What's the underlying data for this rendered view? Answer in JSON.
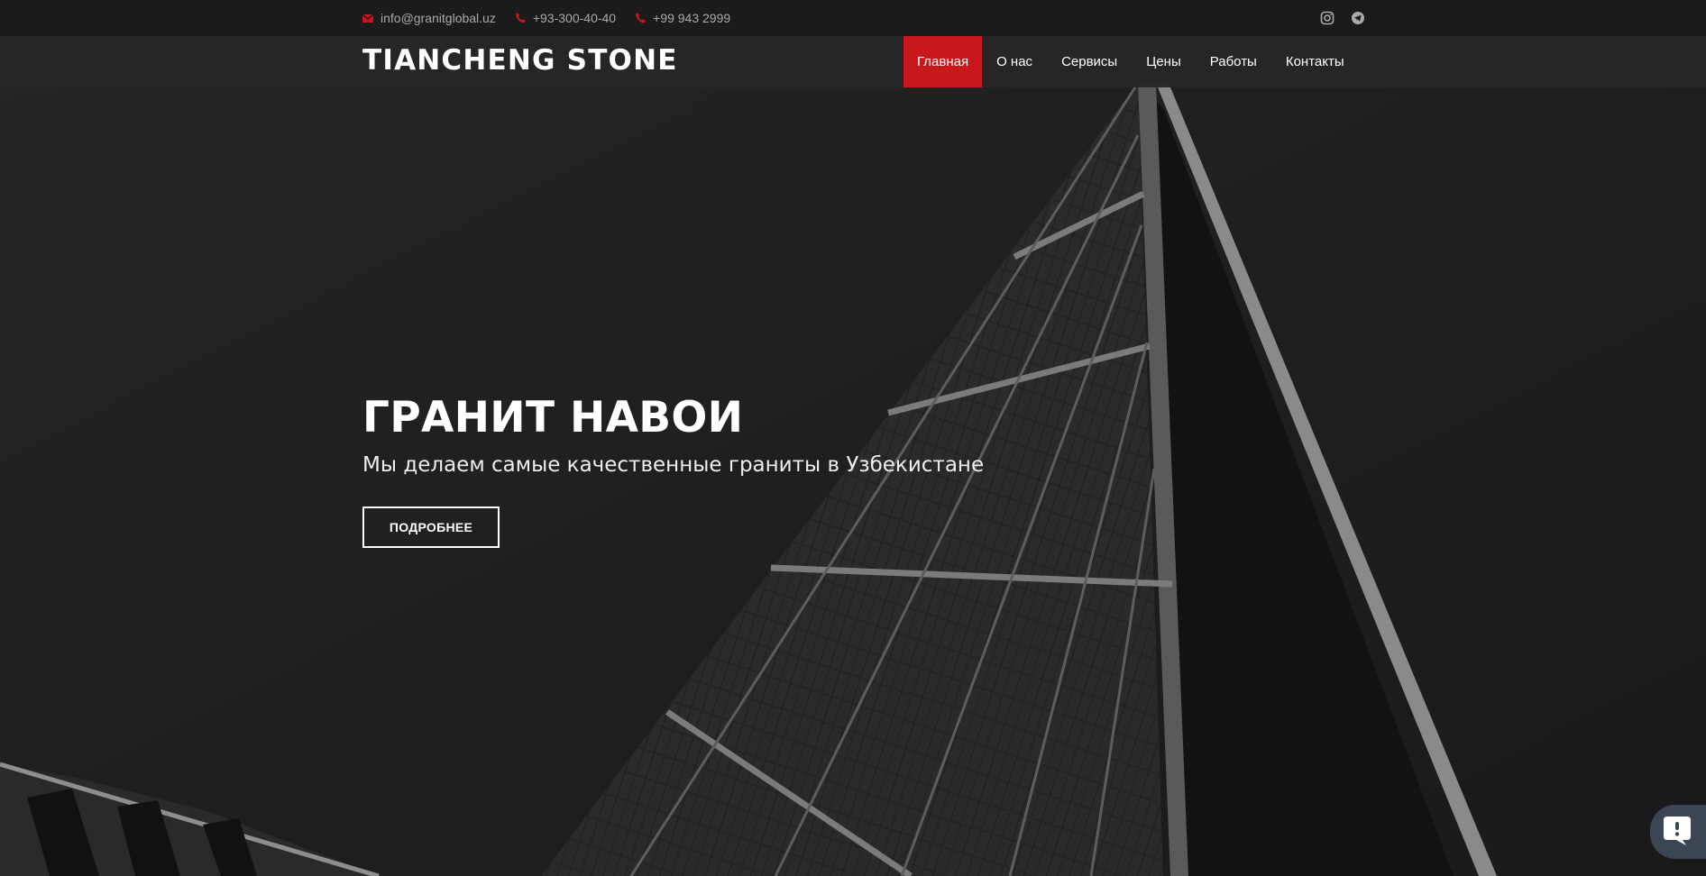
{
  "topbar": {
    "email": "info@granitglobal.uz",
    "phone_1": "+93-300-40-40",
    "phone_2": "+99 943 2999",
    "icons": [
      "envelope-icon",
      "phone-icon",
      "phone-icon",
      "instagram-icon",
      "telegram-icon"
    ]
  },
  "header": {
    "logo": "TIANCHENG STONE",
    "menu": [
      {
        "label": "Главная",
        "active": true
      },
      {
        "label": "О нас",
        "active": false
      },
      {
        "label": "Сервисы",
        "active": false
      },
      {
        "label": "Цены",
        "active": false
      },
      {
        "label": "Работы",
        "active": false
      },
      {
        "label": "Контакты",
        "active": false
      }
    ]
  },
  "hero": {
    "title": "ГРАНИТ НАВОИ",
    "subtitle": "Мы делаем самые качественные граниты в Узбекистане",
    "button": "ПОДРОБНЕЕ"
  },
  "colors": {
    "accent": "#c8181c",
    "background": "#1e1e1f",
    "topbar": "#1b1b1c",
    "navbar": "#262729",
    "chat_widget": "#3c4554"
  }
}
